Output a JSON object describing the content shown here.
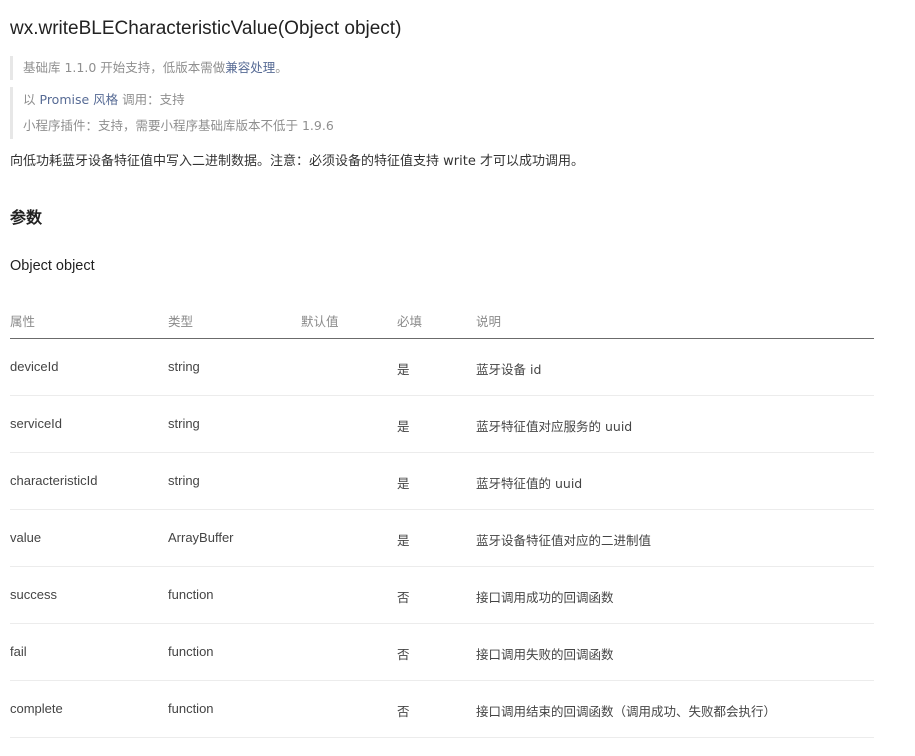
{
  "title": "wx.writeBLECharacteristicValue(Object object)",
  "notes": {
    "base_lib_prefix": "基础库 1.1.0 开始支持，低版本需做",
    "compat_link": "兼容处理",
    "base_lib_suffix": "。",
    "promise_prefix": "以",
    "promise_style": "Promise 风格",
    "promise_suffix": "调用：支持",
    "plugin_text": "小程序插件：支持，需要小程序基础库版本不低于 1.9.6"
  },
  "description": "向低功耗蓝牙设备特征值中写入二进制数据。注意：必须设备的特征值支持 write 才可以成功调用。",
  "params_heading": "参数",
  "object_heading": "Object object",
  "table": {
    "headers": [
      "属性",
      "类型",
      "默认值",
      "必填",
      "说明"
    ],
    "rows": [
      {
        "name": "deviceId",
        "type": "string",
        "default": "",
        "required": "是",
        "desc": "蓝牙设备 id"
      },
      {
        "name": "serviceId",
        "type": "string",
        "default": "",
        "required": "是",
        "desc": "蓝牙特征值对应服务的 uuid"
      },
      {
        "name": "characteristicId",
        "type": "string",
        "default": "",
        "required": "是",
        "desc": "蓝牙特征值的 uuid"
      },
      {
        "name": "value",
        "type": "ArrayBuffer",
        "default": "",
        "required": "是",
        "desc": "蓝牙设备特征值对应的二进制值"
      },
      {
        "name": "success",
        "type": "function",
        "default": "",
        "required": "否",
        "desc": "接口调用成功的回调函数"
      },
      {
        "name": "fail",
        "type": "function",
        "default": "",
        "required": "否",
        "desc": "接口调用失败的回调函数"
      },
      {
        "name": "complete",
        "type": "function",
        "default": "",
        "required": "否",
        "desc": "接口调用结束的回调函数（调用成功、失败都会执行）"
      }
    ]
  },
  "colors": {
    "link": "#576b95",
    "muted": "#8f8f8f",
    "text": "#333333"
  }
}
